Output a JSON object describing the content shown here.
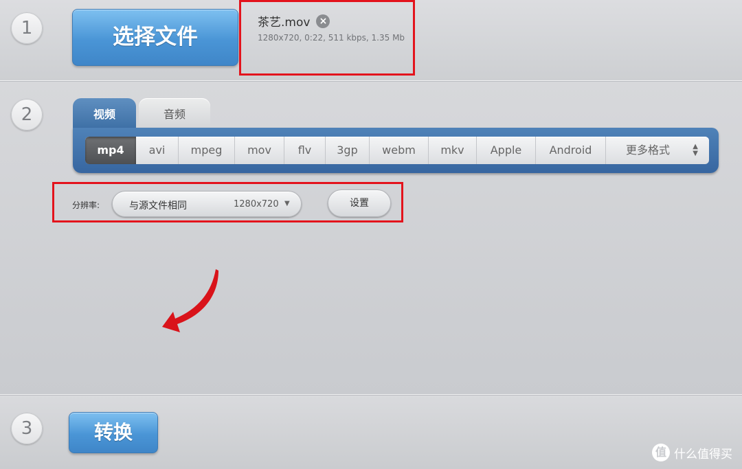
{
  "steps": [
    "1",
    "2",
    "3"
  ],
  "choose_file_label": "选择文件",
  "file": {
    "name": "茶艺.mov",
    "info": "1280x720, 0:22, 511 kbps, 1.35 Mb"
  },
  "tabs": [
    {
      "label": "视频",
      "active": true
    },
    {
      "label": "音频",
      "active": false
    }
  ],
  "formats": [
    {
      "label": "mp4",
      "active": true
    },
    {
      "label": "avi"
    },
    {
      "label": "mpeg"
    },
    {
      "label": "mov"
    },
    {
      "label": "flv"
    },
    {
      "label": "3gp"
    },
    {
      "label": "webm"
    },
    {
      "label": "mkv"
    },
    {
      "label": "Apple"
    },
    {
      "label": "Android"
    },
    {
      "label": "更多格式"
    }
  ],
  "resolution": {
    "label": "分辨率:",
    "selected": "与源文件相同",
    "size": "1280x720",
    "settings_label": "设置"
  },
  "convert_label": "转换",
  "watermark": {
    "logo": "值",
    "text": "什么值得买"
  },
  "colors": {
    "accent_blue": "#4a95d6",
    "highlight_red": "#e3131c",
    "arrow_red": "#d9131a"
  }
}
